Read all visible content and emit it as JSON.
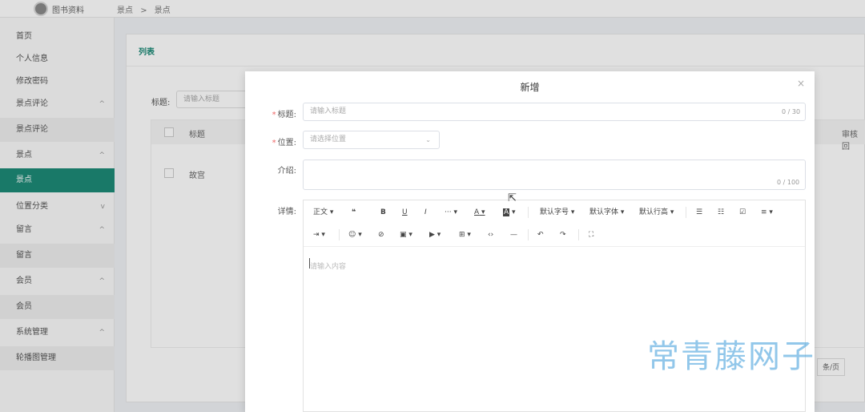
{
  "app": {
    "title": "图书资料"
  },
  "breadcrumb": {
    "items": [
      "景点",
      "景点"
    ],
    "separator": ">"
  },
  "sidebar": {
    "items": [
      {
        "label": "首页"
      },
      {
        "label": "个人信息"
      },
      {
        "label": "修改密码"
      },
      {
        "label": "景点评论",
        "chevron": "^"
      },
      {
        "label": "景点评论"
      },
      {
        "label": "景点",
        "chevron": "^"
      },
      {
        "label": "景点"
      },
      {
        "label": "位置分类",
        "chevron": "v"
      },
      {
        "label": "留言",
        "chevron": "^"
      },
      {
        "label": "留言"
      },
      {
        "label": "会员",
        "chevron": "^"
      },
      {
        "label": "会员"
      },
      {
        "label": "系统管理",
        "chevron": "^"
      },
      {
        "label": "轮播图管理"
      }
    ]
  },
  "main": {
    "card_title": "列表",
    "search": {
      "label": "标题:",
      "placeholder": "请输入标题"
    },
    "table": {
      "columns": [
        "标题",
        "审核回"
      ],
      "rows": [
        {
          "title": "故宫"
        }
      ]
    },
    "pagination": {
      "page_size_label": "条/页"
    }
  },
  "dialog": {
    "title": "新增",
    "close": "×",
    "fields": {
      "title": {
        "label": "标题:",
        "placeholder": "请输入标题",
        "counter": "0 / 30"
      },
      "location": {
        "label": "位置:",
        "placeholder": "请选择位置"
      },
      "intro": {
        "label": "介绍:",
        "counter": "0 / 100"
      },
      "details": {
        "label": "详情:"
      }
    },
    "editor": {
      "placeholder": "请输入内容",
      "toolbar": {
        "heading": "正文",
        "quote": "❝",
        "bold": "B",
        "underline": "U",
        "italic": "I",
        "more": "···",
        "font_color": "A",
        "bg_color": "A",
        "font_size": "默认字号",
        "font_family": "默认字体",
        "line_height": "默认行高",
        "bullet_list": "☰",
        "ordered_list": "☷",
        "todo": "☑",
        "align": "≡",
        "indent": "⇥",
        "emoji": "☺",
        "link": "⊘",
        "image": "▣",
        "video": "▶",
        "table": "⊞",
        "code": "‹›",
        "divider": "—",
        "undo": "↶",
        "redo": "↷",
        "fullscreen": "⛶"
      }
    }
  },
  "watermark": "常青藤网子",
  "colors": {
    "accent": "#1d8a77",
    "required": "#e66666"
  }
}
